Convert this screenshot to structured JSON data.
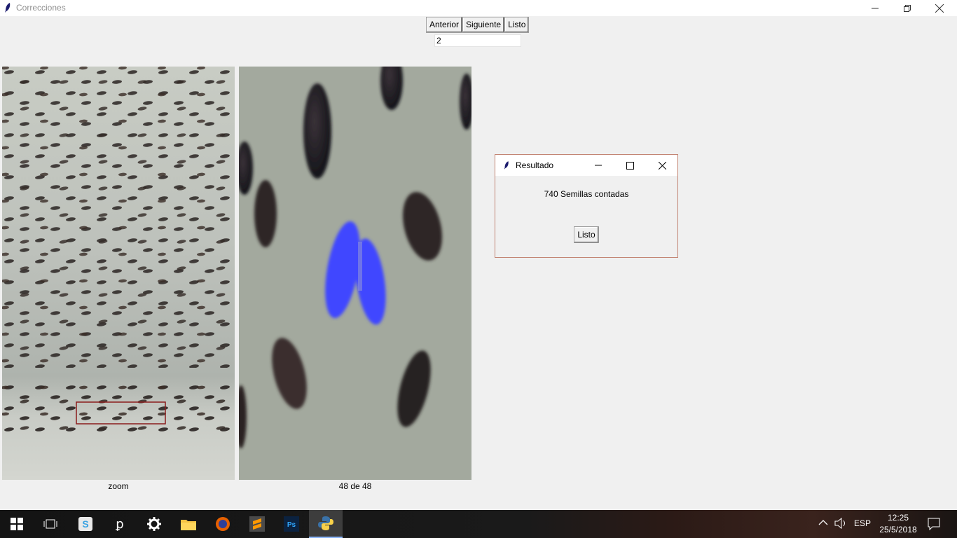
{
  "window": {
    "title": "Correcciones"
  },
  "toolbar": {
    "prev_label": "Anterior",
    "next_label": "Siguiente",
    "done_label": "Listo"
  },
  "entry": {
    "value": "2"
  },
  "captions": {
    "left": "zoom",
    "right": "48 de 48"
  },
  "dialog": {
    "title": "Resultado",
    "message": "740 Semillas contadas",
    "ok_label": "Listo"
  },
  "taskbar": {
    "apps": [
      "start-icon",
      "task-view-icon",
      "slack-icon",
      "pycharm-icon",
      "settings-icon",
      "file-explorer-icon",
      "firefox-icon",
      "sublime-text-icon",
      "photoshop-icon",
      "python-icon"
    ],
    "language": "ESP",
    "time": "12:25",
    "date": "25/5/2018"
  },
  "colors": {
    "highlight": "#3f46ff",
    "selection_rect": "#8b1c1c",
    "dialog_border": "#c28473"
  }
}
